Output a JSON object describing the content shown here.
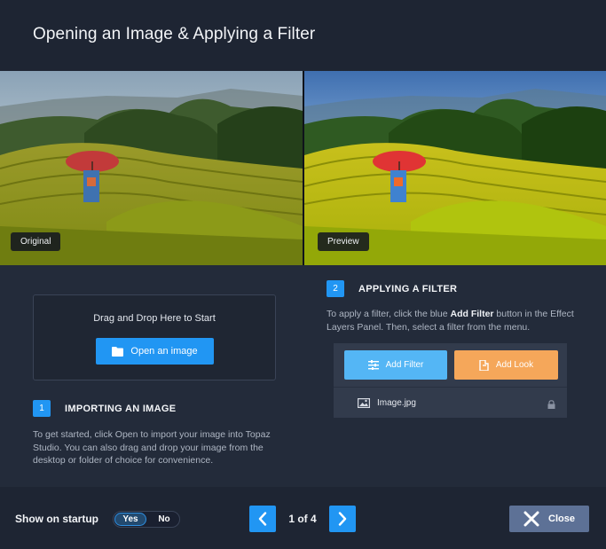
{
  "dialog": {
    "title": "Opening an Image & Applying a Filter"
  },
  "images": {
    "original_label": "Original",
    "preview_label": "Preview"
  },
  "dropzone": {
    "prompt": "Drag and Drop Here to Start",
    "open_button": "Open an image"
  },
  "step1": {
    "number": "1",
    "title": "IMPORTING AN IMAGE",
    "body": "To get started, click Open to import your image into Topaz Studio. You can also drag and drop your image from the desktop or folder of choice for convenience."
  },
  "step2": {
    "number": "2",
    "title": "APPLYING A FILTER",
    "body_pre": "To apply a filter, click the blue ",
    "body_bold": "Add Filter",
    "body_post": " button in the Effect Layers Panel. Then, select a filter from the menu."
  },
  "layers_panel": {
    "add_filter": "Add Filter",
    "add_look": "Add Look",
    "layer_name": "Image.jpg"
  },
  "footer": {
    "startup_label": "Show on startup",
    "toggle_yes": "Yes",
    "toggle_no": "No",
    "toggle_selected": "Yes",
    "page_indicator": "1 of 4",
    "close_label": "Close"
  },
  "icons": {
    "open": "folder-icon",
    "filter": "sliders-icon",
    "look": "look-icon",
    "layer": "image-icon",
    "lock": "lock-icon",
    "prev": "chevron-left-icon",
    "next": "chevron-right-icon",
    "close": "close-x-icon"
  },
  "colors": {
    "accent": "#2196f3",
    "add_filter": "#54b6f5",
    "add_look": "#f5a75a",
    "close_button": "#5d7196"
  }
}
